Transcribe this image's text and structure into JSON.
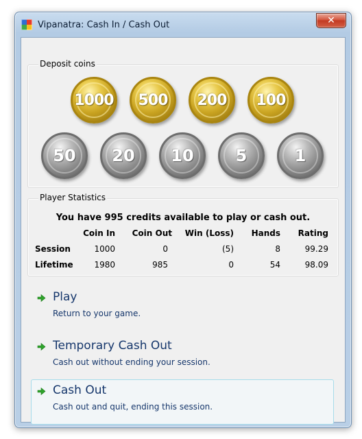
{
  "window": {
    "title": "Vipanatra: Cash In / Cash Out",
    "close_glyph": "✕"
  },
  "deposit": {
    "label": "Deposit coins",
    "gold_coins": [
      "1000",
      "500",
      "200",
      "100"
    ],
    "silver_coins": [
      "50",
      "20",
      "10",
      "5",
      "1"
    ]
  },
  "stats": {
    "label": "Player Statistics",
    "credits_message": "You have 995 credits available to play or cash out.",
    "columns": [
      "",
      "Coin In",
      "Coin Out",
      "Win (Loss)",
      "Hands",
      "Rating"
    ],
    "rows": [
      [
        "Session",
        "1000",
        "0",
        "(5)",
        "8",
        "99.29"
      ],
      [
        "Lifetime",
        "1980",
        "985",
        "0",
        "54",
        "98.09"
      ]
    ]
  },
  "commands": [
    {
      "title": "Play",
      "desc": "Return to your game.",
      "icon": "green-arrow-icon"
    },
    {
      "title": "Temporary Cash Out",
      "desc": "Cash out without ending your session.",
      "icon": "green-arrow-icon"
    },
    {
      "title": "Cash Out",
      "desc": "Cash out and quit, ending this session.",
      "icon": "green-arrow-icon"
    }
  ],
  "colors": {
    "link_text": "#15366b",
    "arrow_green": "#2ea32b",
    "selected_border": "#a6dcea"
  }
}
